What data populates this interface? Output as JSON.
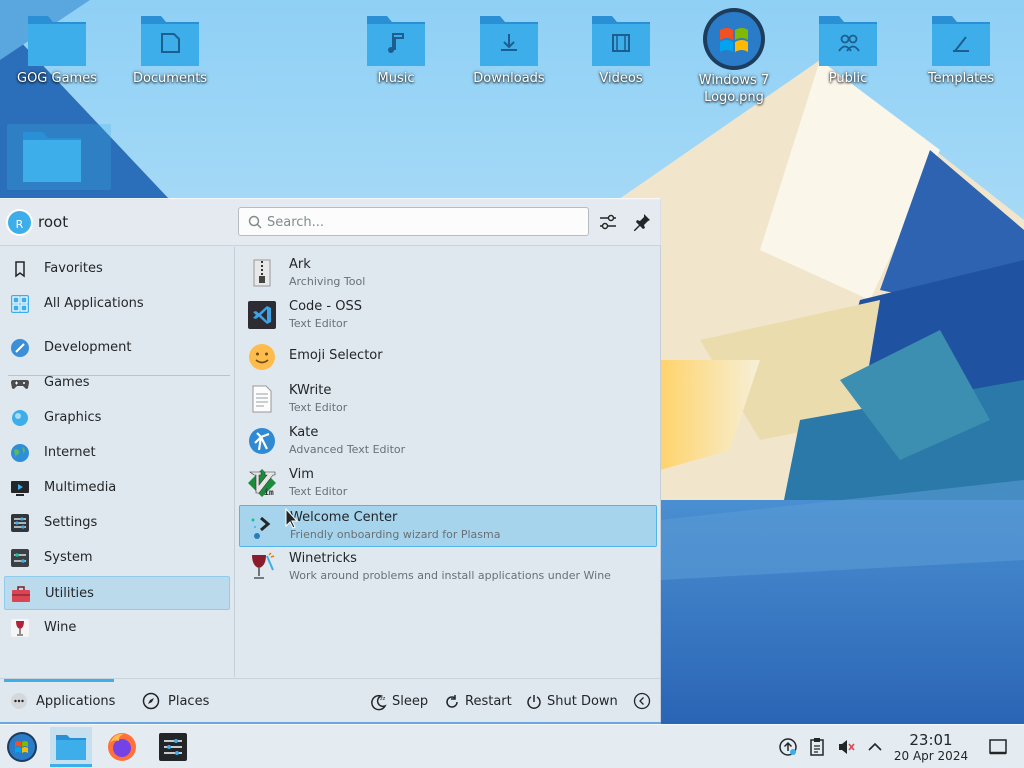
{
  "desktop": {
    "icons": [
      {
        "label": "GOG Games",
        "glyph": ""
      },
      {
        "label": "Documents",
        "glyph": "document"
      },
      {
        "label": "Music",
        "glyph": "music-note"
      },
      {
        "label": "Downloads",
        "glyph": "download"
      },
      {
        "label": "Videos",
        "glyph": "film"
      },
      {
        "label": "Windows 7 Logo.png",
        "glyph": "windows-logo"
      },
      {
        "label": "Public",
        "glyph": "people"
      },
      {
        "label": "Templates",
        "glyph": "template"
      },
      {
        "label": "",
        "glyph": ""
      }
    ]
  },
  "launcher": {
    "user": {
      "initial": "R",
      "name": "root"
    },
    "search": {
      "placeholder": "Search..."
    },
    "categories": [
      {
        "label": "Favorites",
        "icon": "bookmark-icon"
      },
      {
        "label": "All Applications",
        "icon": "grid-icon"
      },
      {
        "label": "Development",
        "icon": "development-icon"
      },
      {
        "label": "Games",
        "icon": "gamepad-icon"
      },
      {
        "label": "Graphics",
        "icon": "graphics-icon"
      },
      {
        "label": "Internet",
        "icon": "globe-icon"
      },
      {
        "label": "Multimedia",
        "icon": "multimedia-icon"
      },
      {
        "label": "Settings",
        "icon": "settings-icon"
      },
      {
        "label": "System",
        "icon": "system-icon"
      },
      {
        "label": "Utilities",
        "icon": "toolbox-icon",
        "active": true
      },
      {
        "label": "Wine",
        "icon": "wine-glass-icon"
      }
    ],
    "apps": [
      {
        "name": "Ark",
        "desc": "Archiving Tool"
      },
      {
        "name": "Code - OSS",
        "desc": "Text Editor"
      },
      {
        "name": "Emoji Selector",
        "desc": ""
      },
      {
        "name": "KWrite",
        "desc": "Text Editor"
      },
      {
        "name": "Kate",
        "desc": "Advanced Text Editor"
      },
      {
        "name": "Vim",
        "desc": "Text Editor"
      },
      {
        "name": "Welcome Center",
        "desc": "Friendly onboarding wizard for Plasma",
        "hover": true
      },
      {
        "name": "Winetricks",
        "desc": "Work around problems and install applications under Wine"
      }
    ],
    "footer": {
      "tabs": [
        {
          "label": "Applications",
          "active": true
        },
        {
          "label": "Places"
        }
      ],
      "sleep": "Sleep",
      "restart": "Restart",
      "shutdown": "Shut Down"
    }
  },
  "taskbar": {
    "clock": {
      "time": "23:01",
      "date": "20 Apr 2024"
    }
  },
  "colors": {
    "accent": "#3daee9",
    "folder": "#3daee9",
    "panel": "#eff0f1"
  }
}
